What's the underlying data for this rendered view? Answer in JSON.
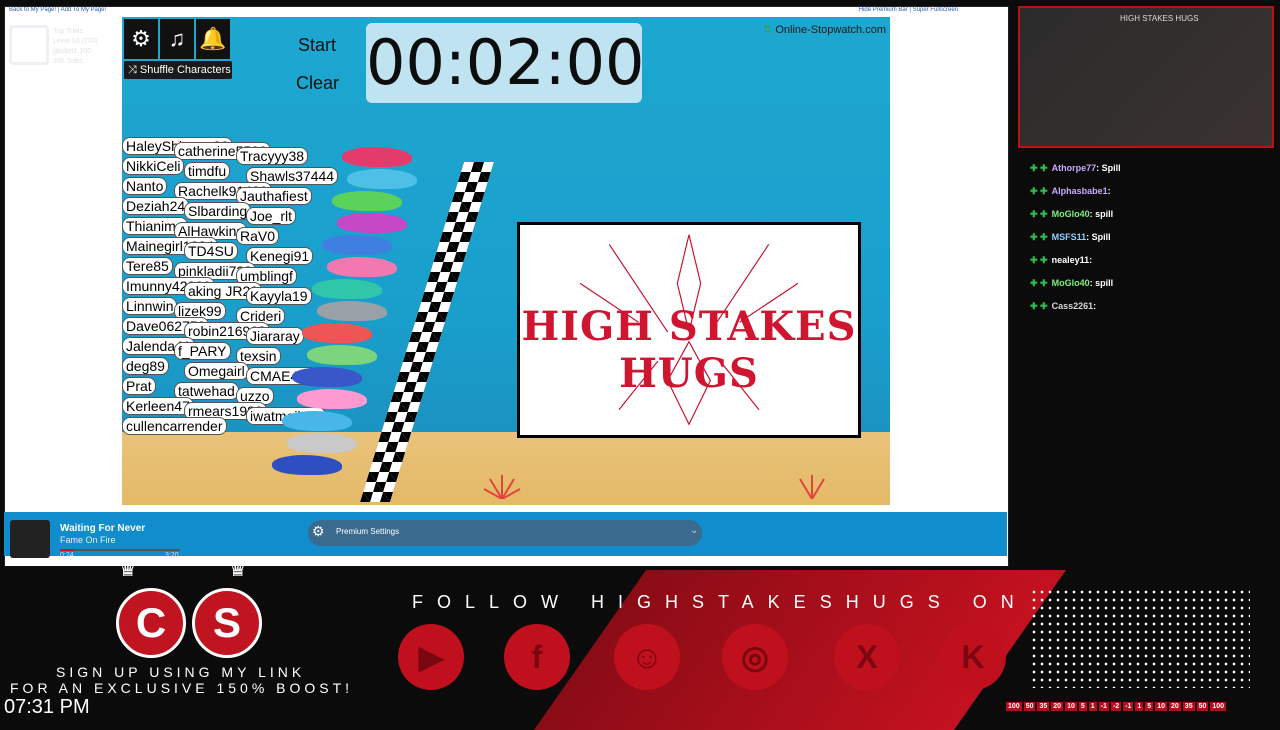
{
  "browser": {
    "top_left_links": "Back to My Page! | Add To My Page!",
    "top_right_links": "Hide Premium Bar | Super Fullscreen",
    "ghost_panel": [
      "Top Trials",
      "Level 10 (270)",
      "gbullet1 100",
      "100 Subs"
    ]
  },
  "stopwatch": {
    "brand": "Online-Stopwatch.com",
    "shuffle_label": "Shuffle Characters",
    "start_label": "Start",
    "clear_label": "Clear",
    "time": "00:02:00"
  },
  "race_names": [
    "HaleyShianne22",
    "catherine5582",
    "Tracyyy38",
    "NikkiCeli",
    "timdfu",
    "Shawls37444",
    "Nanto",
    "Rachelk91489",
    "Jauthafiest",
    "Deziah24",
    "Slbarding",
    "Joe_rlt",
    "Thianima",
    "AlHawkins",
    "RaV0",
    "Mainegirl1234",
    "TD4SU",
    "Kenegi91",
    "Tere85",
    "pinkladii723",
    "umblingf",
    "Imunny42000",
    "aking JR22",
    "Kayyla19",
    "Linnwin",
    "lizek99",
    "Crideri",
    "Dave062758",
    "robin216963",
    "Jiararay",
    "Jalenda41",
    "f_PARY",
    "texsin",
    "deg89",
    "Omegairl",
    "CMAE421",
    "Prat",
    "tatwehad",
    "uzzo",
    "Kerleen47",
    "rmears1989",
    "iwatmeiluck",
    "cullencarrender"
  ],
  "logo": {
    "text": "HIGH STAKES HUGS"
  },
  "now_playing": {
    "title": "Waiting For Never",
    "artist": "Fame On Fire",
    "time_elapsed": "0:24",
    "time_total": "3:20",
    "progress": 0.12
  },
  "premium_settings_label": "Premium Settings",
  "webcam": {
    "label": "HIGH STAKES HUGS"
  },
  "chat": [
    {
      "user": "Athorpe77",
      "msg": ": Spill",
      "color": "#c9a8ff"
    },
    {
      "user": "Alphasbabe1",
      "msg": ":",
      "color": "#c9a8ff"
    },
    {
      "user": "MoGlo40",
      "msg": ": spill",
      "color": "#7cf07c"
    },
    {
      "user": "MSFS11",
      "msg": ": Spill",
      "color": "#8fd0ff"
    },
    {
      "user": "nealey11",
      "msg": ":",
      "color": "#ffffff"
    },
    {
      "user": "MoGlo40",
      "msg": ": spill",
      "color": "#7cf07c"
    },
    {
      "user": "Cass2261",
      "msg": ":",
      "color": "#d8d8d8"
    }
  ],
  "overlay": {
    "cs_letters": [
      "C",
      "S"
    ],
    "signup_line1": "SIGN UP USING MY LINK",
    "signup_line2": "FOR AN EXCLUSIVE 150% BOOST!",
    "clock": "07:31 PM",
    "follow": "FOLLOW HIGHSTAKESHUGS ON",
    "socials": [
      "youtube-icon",
      "facebook-icon",
      "discord-icon",
      "instagram-icon",
      "x-icon",
      "kick-icon"
    ],
    "multipliers": [
      "100",
      "50",
      "35",
      "20",
      "10",
      "5",
      "1",
      "-1",
      "-2",
      "-1",
      "1",
      "5",
      "10",
      "20",
      "35",
      "50",
      "100"
    ]
  }
}
